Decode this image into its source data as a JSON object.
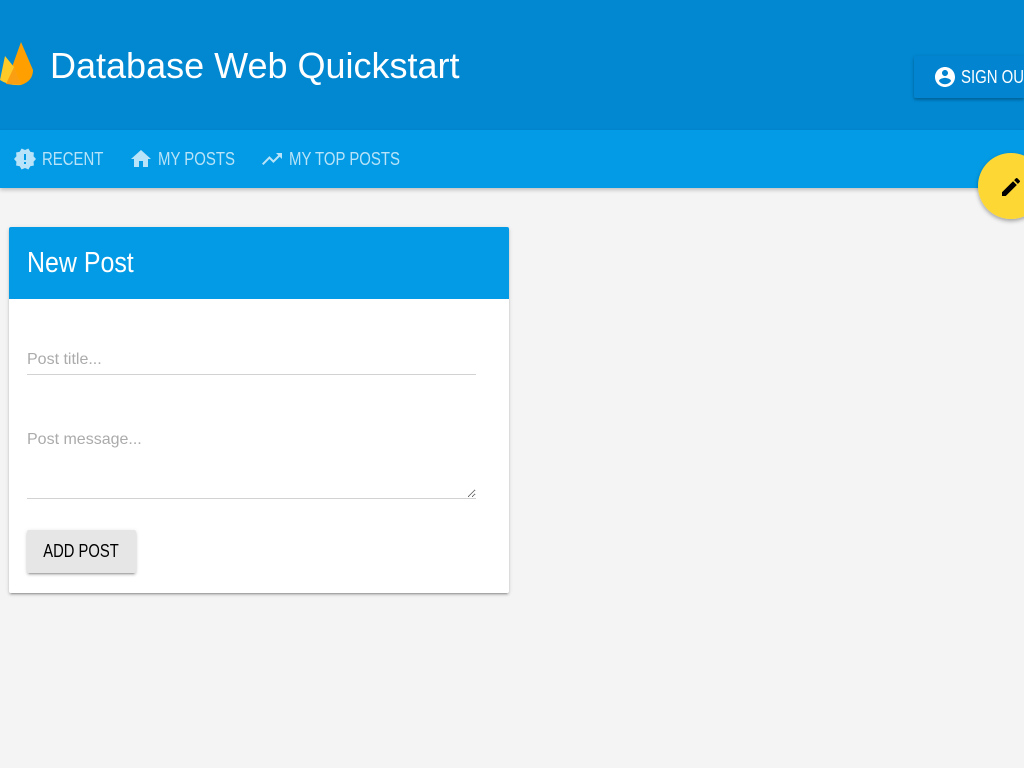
{
  "app": {
    "title": "Database Web Quickstart",
    "logo_icon": "firebase-flame-icon"
  },
  "header": {
    "sign_out": {
      "label": "SIGN OU",
      "icon": "account-circle-icon"
    }
  },
  "tabs": [
    {
      "label": "RECENT",
      "icon": "new-releases-icon"
    },
    {
      "label": "MY POSTS",
      "icon": "home-icon"
    },
    {
      "label": "MY TOP POSTS",
      "icon": "trending-up-icon"
    }
  ],
  "new_post": {
    "heading": "New Post",
    "title_field": {
      "placeholder": "Post title..."
    },
    "message_field": {
      "placeholder": "Post message..."
    },
    "submit_label": "ADD POST"
  },
  "fab": {
    "icon": "pencil-icon"
  },
  "colors": {
    "header_bg": "#0288d1",
    "tabbar_bg": "#039be5",
    "card_header_bg": "#039be5",
    "fab_bg": "#fdd835",
    "page_bg": "#f4f4f4",
    "button_bg": "#e6e6e6"
  }
}
